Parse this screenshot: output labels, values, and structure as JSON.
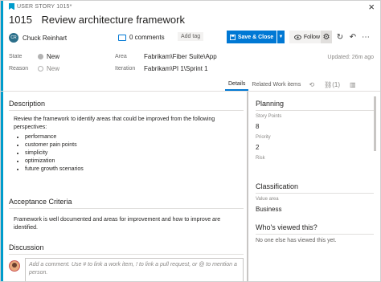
{
  "breadcrumb": "USER STORY 1015*",
  "close_glyph": "×",
  "work_item": {
    "id": "1015",
    "title": "Review architecture framework"
  },
  "owner": {
    "initials": "CR",
    "name": "Chuck Reinhart"
  },
  "toolbar": {
    "comments": "0 comments",
    "add_tag": "Add tag",
    "save_label": "Save & Close",
    "follow_label": "Follow",
    "save_icon": "save-icon",
    "accent": "#0078d4"
  },
  "fields": {
    "state_label": "State",
    "state_value": "New",
    "reason_label": "Reason",
    "reason_value": "New",
    "area_label": "Area",
    "area_value": "Fabrikam\\Fiber Suite\\App",
    "iteration_label": "Iteration",
    "iteration_value": "Fabrikam\\PI 1\\Sprint 1",
    "updated": "Updated: 26m ago"
  },
  "tabs": {
    "details": "Details",
    "related": "Related Work items",
    "links_count": "(1)"
  },
  "description": {
    "title": "Description",
    "text": "Review the framework to identify areas that could be improved from the following perspectives:",
    "items": [
      "performance",
      "customer pain points",
      "simplicity",
      "optimization",
      "future growth scenarios"
    ]
  },
  "acceptance": {
    "title": "Acceptance Criteria",
    "text": "Framework is well documented and areas for improvement and how to improve are identified."
  },
  "discussion": {
    "title": "Discussion",
    "placeholder": "Add a comment. Use # to link a work item, ! to link a pull request, or @ to mention a person."
  },
  "planning": {
    "title": "Planning",
    "story_points_label": "Story Points",
    "story_points": "8",
    "priority_label": "Priority",
    "priority": "2",
    "risk_label": "Risk"
  },
  "classification": {
    "title": "Classification",
    "value_area_label": "Value area",
    "value_area": "Business"
  },
  "viewed": {
    "title": "Who's viewed this?",
    "text": "No one else has viewed this yet."
  }
}
